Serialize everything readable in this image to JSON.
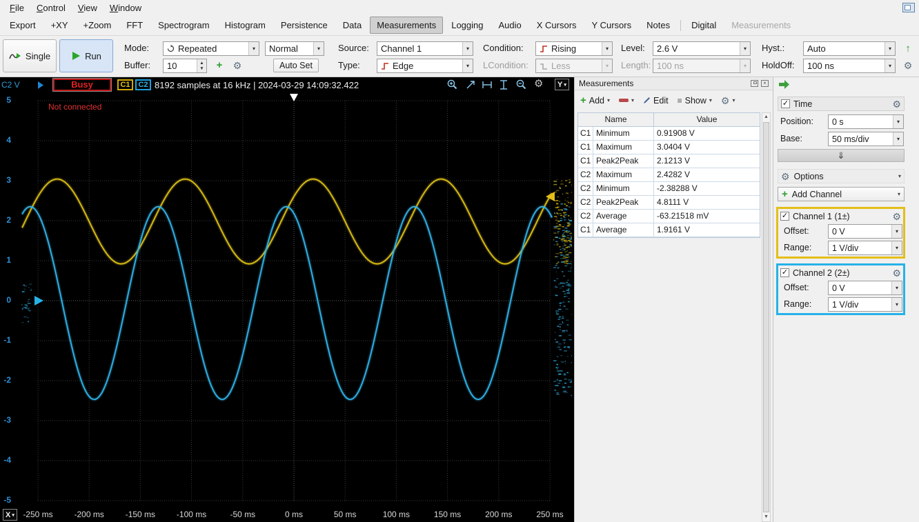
{
  "window": {
    "menu": [
      "File",
      "Control",
      "View",
      "Window"
    ]
  },
  "tabs": {
    "items": [
      "Export",
      "+XY",
      "+Zoom",
      "FFT",
      "Spectrogram",
      "Histogram",
      "Persistence",
      "Data",
      "Measurements",
      "Logging",
      "Audio",
      "X Cursors",
      "Y Cursors",
      "Notes",
      "Digital",
      "Measurements"
    ],
    "active_index": 8,
    "disabled_index": 15
  },
  "toolbar": {
    "single": "Single",
    "run": "Run",
    "mode_label": "Mode:",
    "mode": "Repeated",
    "trigger_mode": "Normal",
    "buffer_label": "Buffer:",
    "buffer": "10",
    "autoset": "Auto Set",
    "source_label": "Source:",
    "source": "Channel 1",
    "type_label": "Type:",
    "type": "Edge",
    "condition_label": "Condition:",
    "condition": "Rising",
    "lcondition_label": "LCondition:",
    "lcondition": "Less",
    "level_label": "Level:",
    "level": "2.6 V",
    "length_label": "Length:",
    "length": "100 ns",
    "hyst_label": "Hyst.:",
    "hyst": "Auto",
    "holdoff_label": "HoldOff:",
    "holdoff": "100 ns"
  },
  "scope": {
    "axis_corner": "C2 V",
    "busy": "Busy",
    "c1_badge": "C1",
    "c2_badge": "C2",
    "status_info": "8192 samples at 16 kHz | 2024-03-29 14:09:32.422",
    "not_connected": "Not connected",
    "y_badge": "Y",
    "x_badge": "X",
    "y_ticks": [
      "5",
      "4",
      "3",
      "2",
      "1",
      "0",
      "-1",
      "-2",
      "-3",
      "-4",
      "-5"
    ],
    "x_ticks": [
      "-250 ms",
      "-200 ms",
      "-150 ms",
      "-100 ms",
      "-50 ms",
      "0 ms",
      "50 ms",
      "100 ms",
      "150 ms",
      "200 ms",
      "250 ms"
    ]
  },
  "chart_data": {
    "type": "line",
    "title": "Oscilloscope time-domain capture",
    "x": {
      "unit": "ms",
      "min": -250,
      "max": 250,
      "divisions": 10,
      "per_div": "50 ms/div"
    },
    "y": {
      "unit": "V",
      "min": -5,
      "max": 5,
      "divisions": 10,
      "per_div": "1 V/div"
    },
    "grid": true,
    "series": [
      {
        "name": "Channel 1",
        "color": "#d9bd14",
        "waveform": "sine",
        "frequency_hz": 8,
        "amplitude_v": 1.06,
        "offset_v": 1.98,
        "phase_rad": 0.63,
        "measured_min_v": 0.91908,
        "measured_max_v": 3.0404
      },
      {
        "name": "Channel 2",
        "color": "#2fb3e8",
        "waveform": "sine",
        "frequency_hz": 8,
        "amplitude_v": 2.41,
        "offset_v": -0.06,
        "phase_rad": 1.95,
        "measured_min_v": -2.38288,
        "measured_max_v": 2.4282
      }
    ],
    "trigger": {
      "source": "Channel 1",
      "condition": "Rising",
      "level_v": 2.6,
      "position_ms": 0
    }
  },
  "measurements": {
    "title": "Measurements",
    "toolbar": {
      "add": "Add",
      "edit": "Edit",
      "show": "Show"
    },
    "columns": [
      "Name",
      "Value"
    ],
    "rows": [
      [
        "C1",
        "Minimum",
        "0.91908 V"
      ],
      [
        "C1",
        "Maximum",
        "3.0404 V"
      ],
      [
        "C1",
        "Peak2Peak",
        "2.1213 V"
      ],
      [
        "C2",
        "Maximum",
        "2.4282 V"
      ],
      [
        "C2",
        "Minimum",
        "-2.38288 V"
      ],
      [
        "C2",
        "Peak2Peak",
        "4.8111 V"
      ],
      [
        "C2",
        "Average",
        "-63.21518 mV"
      ],
      [
        "C1",
        "Average",
        "1.9161 V"
      ]
    ]
  },
  "right_panel": {
    "time": {
      "label": "Time",
      "position_label": "Position:",
      "position": "0 s",
      "base_label": "Base:",
      "base": "50 ms/div"
    },
    "options": "Options",
    "add_channel": "Add Channel",
    "channels": [
      {
        "label": "Channel 1 (1±)",
        "offset_label": "Offset:",
        "offset": "0 V",
        "range_label": "Range:",
        "range": "1 V/div",
        "accent": "#e4be17"
      },
      {
        "label": "Channel 2 (2±)",
        "offset_label": "Offset:",
        "offset": "0 V",
        "range_label": "Range:",
        "range": "1 V/div",
        "accent": "#25b2e8"
      }
    ]
  }
}
